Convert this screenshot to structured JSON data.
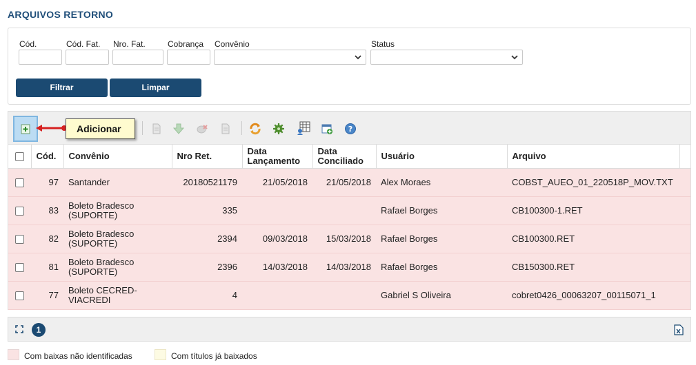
{
  "page": {
    "title": "ARQUIVOS RETORNO"
  },
  "filters": {
    "cod_label": "Cód.",
    "cod_fat_label": "Cód. Fat.",
    "nro_fat_label": "Nro. Fat.",
    "cobranca_label": "Cobrança",
    "convenio_label": "Convênio",
    "status_label": "Status",
    "filtrar_label": "Filtrar",
    "limpar_label": "Limpar"
  },
  "toolbar": {
    "add_tooltip": "Adicionar",
    "icons": [
      "add-icon",
      "document-icon",
      "download-arrow-icon",
      "remove-icon",
      "page-icon",
      "refresh-icon",
      "settings-icon",
      "spreadsheet-icon",
      "window-add-icon",
      "help-icon"
    ]
  },
  "table": {
    "columns": [
      "Cód.",
      "Convênio",
      "Nro Ret.",
      "Data Lançamento",
      "Data Conciliado",
      "Usuário",
      "Arquivo"
    ],
    "rows": [
      {
        "cod": "97",
        "convenio": "Santander",
        "nro_ret": "20180521179",
        "data_lancamento": "21/05/2018",
        "data_conciliado": "21/05/2018",
        "usuario": "Alex Moraes",
        "arquivo": "COBST_AUEO_01_220518P_MOV.TXT"
      },
      {
        "cod": "83",
        "convenio": "Boleto Bradesco (SUPORTE)",
        "nro_ret": "335",
        "data_lancamento": "",
        "data_conciliado": "",
        "usuario": "Rafael Borges",
        "arquivo": "CB100300-1.RET"
      },
      {
        "cod": "82",
        "convenio": "Boleto Bradesco (SUPORTE)",
        "nro_ret": "2394",
        "data_lancamento": "09/03/2018",
        "data_conciliado": "15/03/2018",
        "usuario": "Rafael Borges",
        "arquivo": "CB100300.RET"
      },
      {
        "cod": "81",
        "convenio": "Boleto Bradesco (SUPORTE)",
        "nro_ret": "2396",
        "data_lancamento": "14/03/2018",
        "data_conciliado": "14/03/2018",
        "usuario": "Rafael Borges",
        "arquivo": "CB150300.RET"
      },
      {
        "cod": "77",
        "convenio": "Boleto CECRED-VIACREDI",
        "nro_ret": "4",
        "data_lancamento": "",
        "data_conciliado": "",
        "usuario": "Gabriel S Oliveira",
        "arquivo": "cobret0426_00063207_00115071_1"
      }
    ]
  },
  "pagination": {
    "current_page": "1"
  },
  "legend": {
    "items": [
      {
        "label": "Com baixas não identificadas",
        "color": "#fae3e3"
      },
      {
        "label": "Com títulos já baixados",
        "color": "#fdfbe3"
      }
    ]
  },
  "colors": {
    "primary": "#1b4a72",
    "title": "#1f4e79",
    "row_pink": "#fae3e3",
    "row_yellow": "#fdfbe3"
  }
}
